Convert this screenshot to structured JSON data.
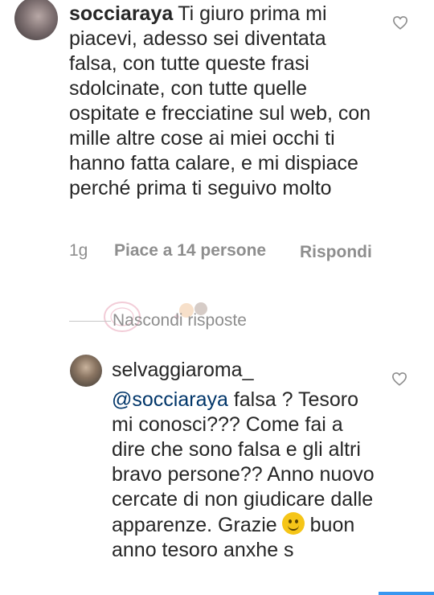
{
  "comment_1": {
    "username": "socciaraya",
    "text": "Ti giuro prima mi piacevi, adesso sei diventata falsa, con tutte queste frasi sdolcinate, con tutte quelle ospitate e frecciatine sul web, con mille altre cose ai miei occhi ti hanno fatta calare, e mi dispiace perché prima ti seguivo molto",
    "age": "1g",
    "likes": "Piace a 14 persone",
    "reply_label": "Rispondi",
    "like_icon": "heart-outline-icon"
  },
  "hide_replies_label": "Nascondi risposte",
  "comment_2": {
    "username": "selvaggiaroma_",
    "mention": "@socciaraya",
    "text": " falsa ? Tesoro mi conosci??? Come fai a dire che sono falsa e gli altri bravo persone?? Anno nuovo cercate di non giudicare dalle apparenze. Grazie",
    "text_tail": " buon anno tesoro anxhe s",
    "emoji": "slightly-smiling-face-emoji",
    "like_icon": "heart-outline-icon"
  },
  "colors": {
    "text": "#262626",
    "meta": "#8e8e8e",
    "mention": "#003569",
    "accent": "#3897f0"
  }
}
